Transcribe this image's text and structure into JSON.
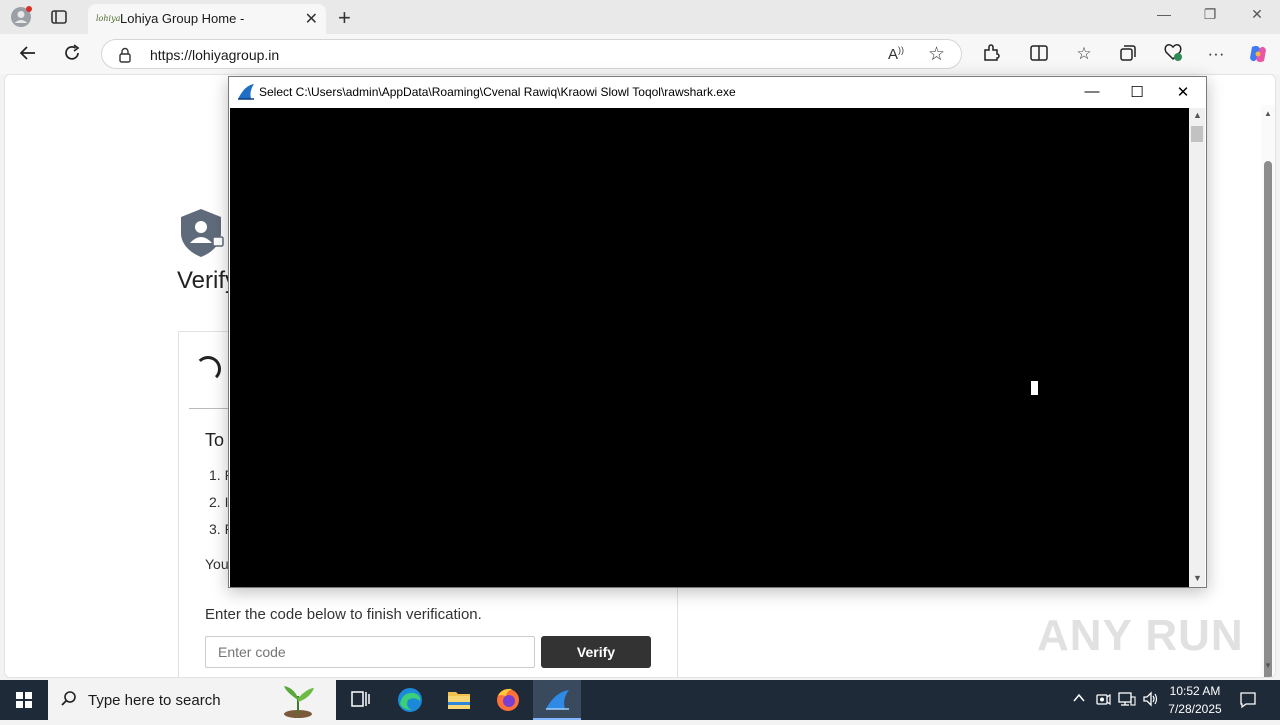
{
  "browser": {
    "tab_title": "Lohiya Group Home -",
    "tab_favicon_text": "lohiya",
    "url": "https://lohiyagroup.in"
  },
  "page": {
    "heading": "Verify",
    "instructions_heading": "To",
    "steps": [
      "1. F",
      "2. I",
      "3. F"
    ],
    "paragraph": "You",
    "finish_text": "Enter the code below to finish verification.",
    "code_placeholder": "Enter code",
    "verify_label": "Verify",
    "watermark": "ANY RUN"
  },
  "console": {
    "title": "Select C:\\Users\\admin\\AppData\\Roaming\\Cvenal Rawiq\\Kraowi Slowl Toqol\\rawshark.exe"
  },
  "taskbar": {
    "search_placeholder": "Type here to search",
    "time": "10:52 AM",
    "date": "7/28/2025"
  },
  "colors": {
    "accent": "#0067c0",
    "console_bg": "#000000",
    "taskbar_bg": "#1f2a38"
  }
}
